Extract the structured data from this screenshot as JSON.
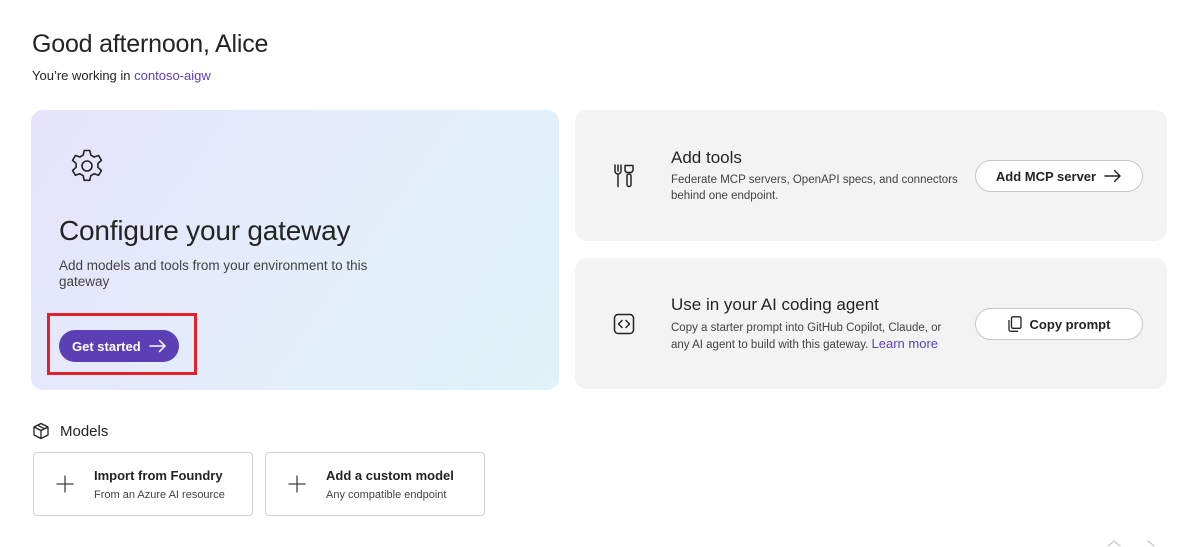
{
  "header": {
    "greeting": "Good afternoon, Alice",
    "workspace_prefix": "You’re working in ",
    "workspace_name": "contoso-aigw"
  },
  "hero": {
    "icon": "gear-icon",
    "title": "Configure your gateway",
    "description": "Add models and tools from your environment to this gateway",
    "button_label": "Get started"
  },
  "cards": {
    "tools": {
      "icon": "tools-icon",
      "title": "Add tools",
      "description": "Federate MCP servers, OpenAPI specs, and connectors behind one endpoint.",
      "button_label": "Add MCP server"
    },
    "agent": {
      "icon": "code-icon",
      "title": "Use in your AI coding agent",
      "description": "Copy a starter prompt into GitHub Copilot, Claude, or any AI agent to build with this gateway. ",
      "link_label": "Learn more",
      "button_label": "Copy prompt"
    }
  },
  "models": {
    "icon": "cube-icon",
    "title": "Models",
    "tiles": [
      {
        "title": "Import from Foundry",
        "subtitle": "From an Azure AI resource"
      },
      {
        "title": "Add a custom model",
        "subtitle": "Any compatible endpoint"
      }
    ]
  },
  "colors": {
    "accent": "#5b3fb5",
    "highlight": "#e0202a",
    "card_bg": "#f3f3f3"
  }
}
